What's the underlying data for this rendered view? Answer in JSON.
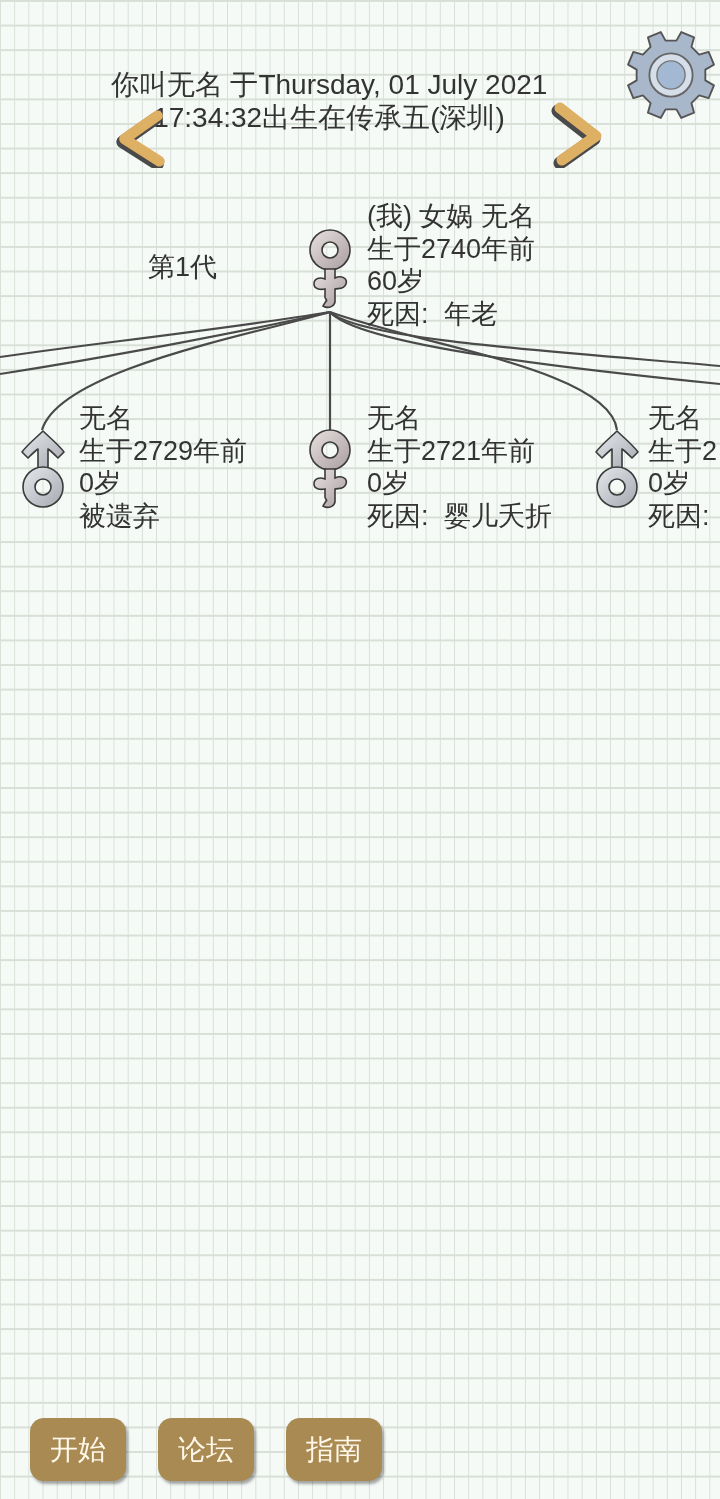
{
  "header": {
    "lines": [
      "你叫无名 于Thursday, 01 July 2021",
      "17:34:32出生在传承五(深圳)"
    ]
  },
  "generation_label": "第1代",
  "tree": {
    "kind": "female",
    "lines": [
      "(我) 女娲 无名",
      "生于2740年前",
      "60岁",
      "死因:  年老"
    ],
    "children": [
      {
        "kind": "male",
        "lines": [
          "无名",
          "生于2729年前",
          "0岁",
          "被遗弃"
        ]
      },
      {
        "kind": "female",
        "lines": [
          "无名",
          "生于2721年前",
          "0岁",
          "死因:  婴儿夭折"
        ]
      },
      {
        "kind": "male",
        "lines": [
          "无名",
          "生于2",
          "0岁",
          "死因:"
        ]
      }
    ]
  },
  "buttons": [
    "开始",
    "论坛",
    "指南"
  ]
}
